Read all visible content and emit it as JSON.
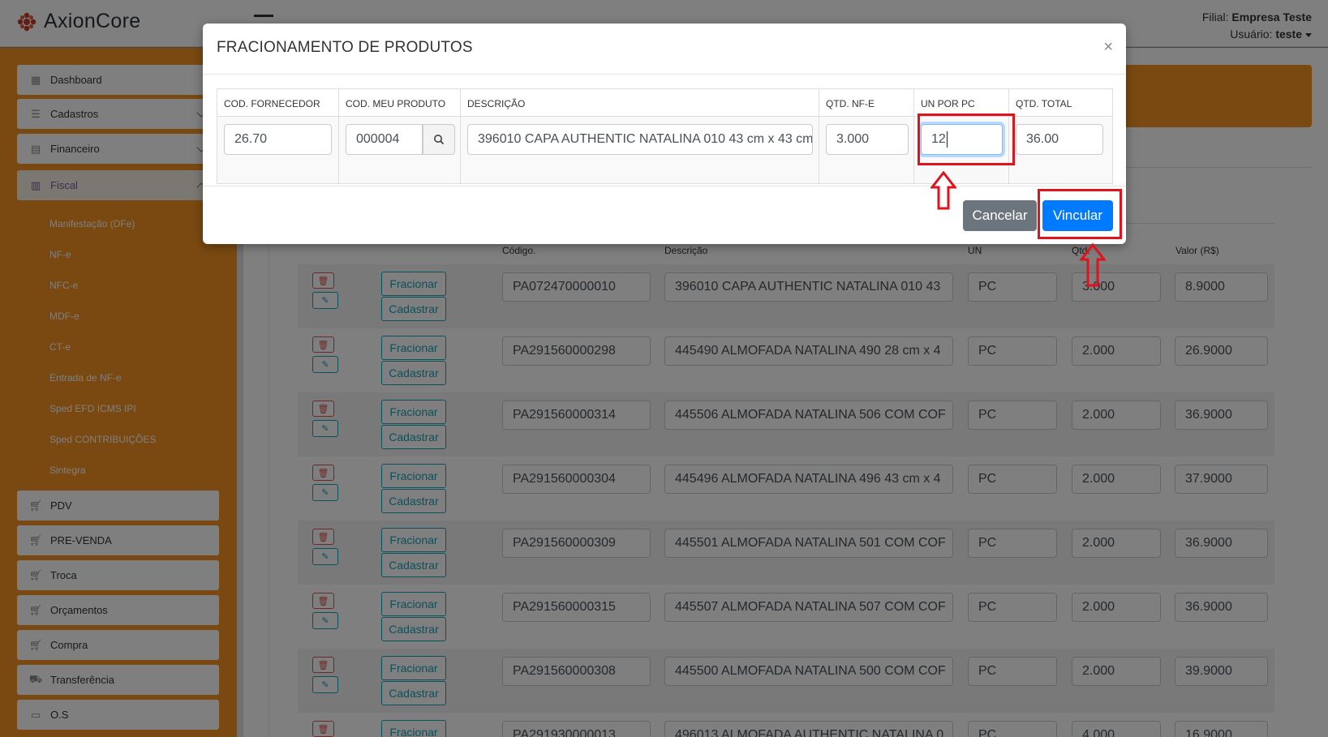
{
  "app": {
    "brand": "AxionCore",
    "filial_label": "Filial:",
    "filial_value": "Empresa Teste",
    "usuario_label": "Usuário:",
    "usuario_value": "teste"
  },
  "sidebar": {
    "items": [
      {
        "label": "Dashboard",
        "icon": "grid-icon"
      },
      {
        "label": "Cadastros",
        "icon": "list-icon"
      },
      {
        "label": "Financeiro",
        "icon": "calculator-icon"
      },
      {
        "label": "Fiscal",
        "icon": "document-icon"
      }
    ],
    "fiscal_sub": [
      "Manifestação (DFe)",
      "NF-e",
      "NFC-e",
      "MDF-e",
      "CT-e",
      "Entrada de NF-e",
      "Sped EFD ICMS IPI",
      "Sped CONTRIBUIÇÕES",
      "Sintegra"
    ],
    "items2": [
      {
        "label": "PDV",
        "icon": "cart-icon"
      },
      {
        "label": "PRE-VENDA",
        "icon": "cart-icon"
      },
      {
        "label": "Troca",
        "icon": "cart-icon"
      },
      {
        "label": "Orçamentos",
        "icon": "cart-icon"
      },
      {
        "label": "Compra",
        "icon": "cart-icon"
      },
      {
        "label": "Transferência",
        "icon": "basket-icon"
      },
      {
        "label": "O.S",
        "icon": "box-icon"
      }
    ]
  },
  "table": {
    "headers": {
      "codigo": "Código.",
      "descricao": "Descrição",
      "un": "UN",
      "qtd": "Qtd.",
      "valor": "Valor (R$)"
    },
    "fracionar_label": "Fracionar",
    "cadastrar_label": "Cadastrar",
    "rows": [
      {
        "codigo": "PA072470000010",
        "descricao": "396010  CAPA AUTHENTIC NATALINA 010 43",
        "un": "PC",
        "qtd": "3.000",
        "valor": "8.9000"
      },
      {
        "codigo": "PA291560000298",
        "descricao": "445490  ALMOFADA NATALINA 490 28 cm x 4",
        "un": "PC",
        "qtd": "2.000",
        "valor": "26.9000"
      },
      {
        "codigo": "PA291560000314",
        "descricao": "445506  ALMOFADA NATALINA 506 COM COF",
        "un": "PC",
        "qtd": "2.000",
        "valor": "36.9000"
      },
      {
        "codigo": "PA291560000304",
        "descricao": "445496  ALMOFADA NATALINA 496 43 cm x 4",
        "un": "PC",
        "qtd": "2.000",
        "valor": "37.9000"
      },
      {
        "codigo": "PA291560000309",
        "descricao": "445501  ALMOFADA NATALINA 501 COM COF",
        "un": "PC",
        "qtd": "2.000",
        "valor": "36.9000"
      },
      {
        "codigo": "PA291560000315",
        "descricao": "445507  ALMOFADA NATALINA 507 COM COF",
        "un": "PC",
        "qtd": "2.000",
        "valor": "36.9000"
      },
      {
        "codigo": "PA291560000308",
        "descricao": "445500  ALMOFADA NATALINA 500 COM COF",
        "un": "PC",
        "qtd": "2.000",
        "valor": "39.9000"
      },
      {
        "codigo": "PA291930000013",
        "descricao": "496013  ALMOFADA AUTHENTIC NATALINA 0",
        "un": "PC",
        "qtd": "4.000",
        "valor": "16.9000"
      }
    ]
  },
  "modal": {
    "title": "FRACIONAMENTO DE PRODUTOS",
    "close": "×",
    "headers": [
      "COD. FORNECEDOR",
      "COD. MEU PRODUTO",
      "DESCRIÇÃO",
      "QTD. NF-E",
      "UN POR PC",
      "QTD. TOTAL"
    ],
    "cod_fornecedor": "26.70",
    "cod_meu_produto": "000004",
    "descricao": "396010  CAPA AUTHENTIC NATALINA 010 43 cm x 43 cm",
    "qtd_nfe": "3.000",
    "un_por_pc": "12",
    "qtd_total": "36.00",
    "cancel_label": "Cancelar",
    "vincular_label": "Vincular"
  },
  "colors": {
    "orange": "#f39323",
    "primary": "#007bff",
    "secondary": "#6c757d",
    "info": "#17a2b8",
    "danger": "#d9534f",
    "annotation_red": "#e0121b"
  }
}
